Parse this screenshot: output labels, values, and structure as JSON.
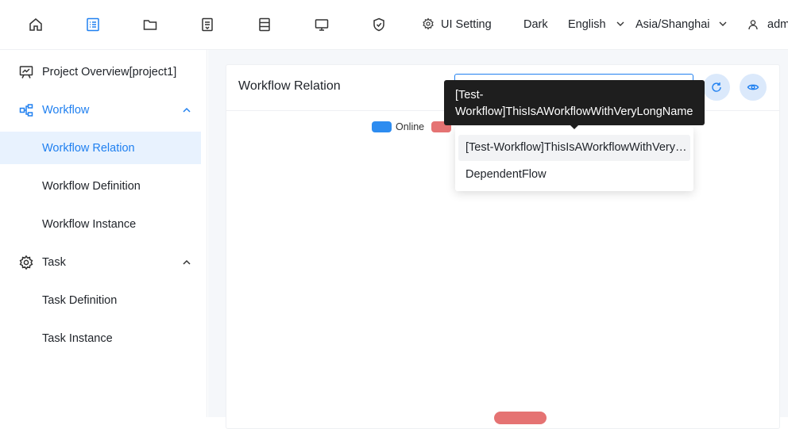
{
  "topbar": {
    "nav_icons": [
      "home-icon",
      "project-icon",
      "folder-icon",
      "datasource-icon",
      "server-icon",
      "monitor-icon",
      "security-icon"
    ],
    "ui_setting_label": "UI Setting",
    "theme_label": "Dark",
    "language_label": "English",
    "timezone_label": "Asia/Shanghai",
    "user_label": "adm"
  },
  "sidebar": {
    "items": [
      {
        "label": "Project Overview[project1]",
        "icon": "presentation-icon"
      },
      {
        "label": "Workflow",
        "icon": "workflow-icon"
      },
      {
        "label": "Workflow Relation"
      },
      {
        "label": "Workflow Definition"
      },
      {
        "label": "Workflow Instance"
      },
      {
        "label": "Task",
        "icon": "gear-icon"
      },
      {
        "label": "Task Definition"
      },
      {
        "label": "Task Instance"
      }
    ]
  },
  "card": {
    "title": "Workflow Relation"
  },
  "legend": {
    "online_label": "Online",
    "online_color": "#2d8cf0",
    "offline_color": "#e57373"
  },
  "dropdown": {
    "options": [
      "[Test-Workflow]ThisIsAWorkflowWithVeryLongName",
      "DependentFlow"
    ]
  },
  "tooltip": {
    "text": "[Test-Workflow]ThisIsAWorkflowWithVeryLongName"
  },
  "colors": {
    "accent": "#2080f0",
    "active_bg": "#e8f2fe"
  }
}
